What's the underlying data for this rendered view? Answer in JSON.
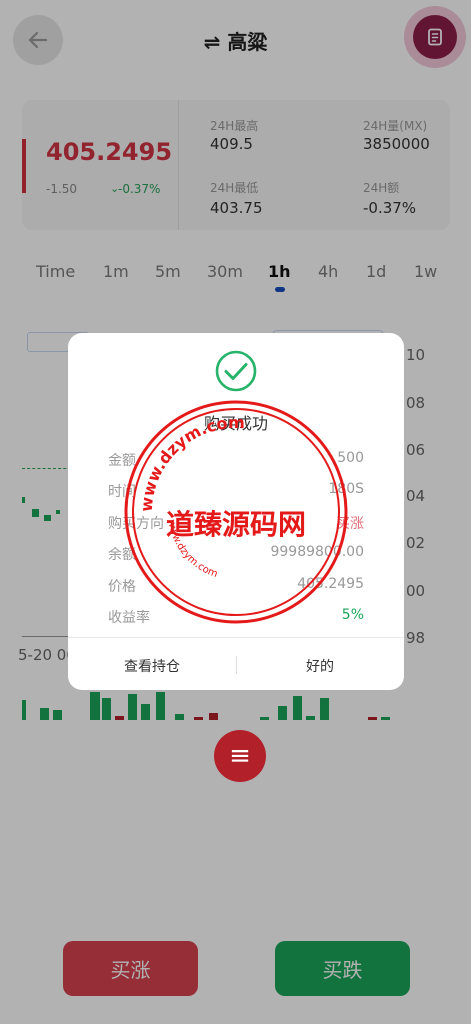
{
  "header": {
    "title": "⇌ 高粱"
  },
  "ticker": {
    "price": "405.2495",
    "change": "-1.50",
    "change_pct": "-0.37%",
    "stats": [
      {
        "label": "24H最高",
        "value": "409.5"
      },
      {
        "label": "24H量(MX)",
        "value": "3850000"
      },
      {
        "label": "24H最低",
        "value": "403.75"
      },
      {
        "label": "24H额",
        "value": "-0.37%"
      }
    ]
  },
  "timeframes": [
    "Time",
    "1m",
    "5m",
    "30m",
    "1h",
    "4h",
    "1d",
    "1w"
  ],
  "chart": {
    "y_ticks": [
      "10",
      "08",
      "06",
      "04",
      "02",
      "00",
      "98"
    ],
    "x_label": "5-20 00"
  },
  "modal": {
    "title": "购买成功",
    "rows": [
      {
        "label": "金额",
        "value": "500"
      },
      {
        "label": "时间",
        "value": "180S"
      },
      {
        "label": "购买方向",
        "value": "买涨"
      },
      {
        "label": "余额",
        "value": "99989800.00"
      },
      {
        "label": "价格",
        "value": "405.2495"
      },
      {
        "label": "收益率",
        "value": "5%"
      }
    ],
    "view_positions": "查看持仓",
    "ok": "好的"
  },
  "watermark": {
    "text": "道臻源码网",
    "ring": "www.dzym.com"
  },
  "actions": {
    "buy": "买涨",
    "sell": "买跌"
  },
  "colors": {
    "up": "#d64350",
    "down": "#1aa55a",
    "accent": "#8c1f4a"
  }
}
